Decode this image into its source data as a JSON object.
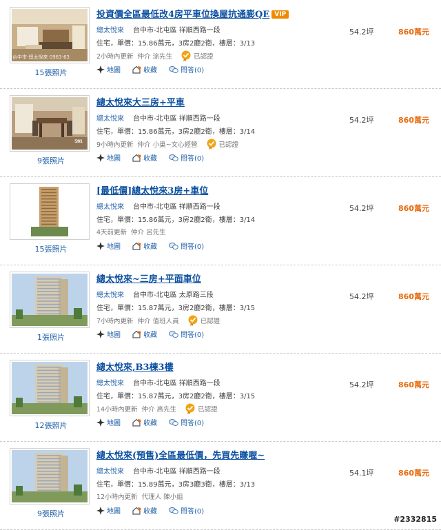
{
  "listings": [
    {
      "title": "投資價全區最低改4房平車位換屋抗通膨QE",
      "vip": "VIP",
      "community": "總太悅來",
      "address": "台中市-北屯區  祥順西路一段",
      "detail": "住宅，單價：15.86萬元，3房2廳2衛，樓層：3/13",
      "update": "2小時內更新",
      "agent": "仲介  涂先生",
      "verified": "已認證",
      "photos": "15張照片",
      "area": "54.2坪",
      "price": "860萬元",
      "actions": {
        "map": "地圖",
        "fav": "收藏",
        "qa": "問答(0)"
      },
      "thumb_type": "interior",
      "thumb_caption": "台中市-總太悅來 0963-63"
    },
    {
      "title": "總太悅來大三房+平車",
      "community": "總太悅來",
      "address": "台中市-北屯區  祥順西路一段",
      "detail": "住宅，單價：15.86萬元，3房2廳2衛，樓層：3/14",
      "update": "9小時內更新",
      "agent": "仲介  小巢~文心經營",
      "verified": "已認證",
      "photos": "9張照片",
      "area": "54.2坪",
      "price": "860萬元",
      "actions": {
        "map": "地圖",
        "fav": "收藏",
        "qa": "問答(0)"
      },
      "thumb_type": "dining",
      "thumb_caption": "591"
    },
    {
      "title": "[最低價]總太悅來3房+車位",
      "community": "總太悅來",
      "address": "台中市-北屯區  祥順西路一段",
      "detail": "住宅，單價：15.86萬元，3房2廳2衛，樓層：3/14",
      "update": "4天前更新",
      "agent": "仲介  呂先生",
      "verified": "",
      "photos": "15張照片",
      "area": "54.2坪",
      "price": "860萬元",
      "actions": {
        "map": "地圖",
        "fav": "收藏",
        "qa": "問答(0)"
      },
      "thumb_type": "tower-warm"
    },
    {
      "title": "總太悅來~三房+平面車位",
      "community": "總太悅來",
      "address": "台中市-北屯區  太原路三段",
      "detail": "住宅，單價：15.87萬元，3房2廳2衛，樓層：3/15",
      "update": "7小時內更新",
      "agent": "仲介  值班人員",
      "verified": "已認證",
      "photos": "1張照片",
      "area": "54.2坪",
      "price": "860萬元",
      "actions": {
        "map": "地圖",
        "fav": "收藏",
        "qa": "問答(0)"
      },
      "thumb_type": "tower"
    },
    {
      "title": "總太悅來,B3棟3樓",
      "community": "總太悅來",
      "address": "台中市-北屯區  祥順西路一段",
      "detail": "住宅，單價：15.87萬元，3房2廳2衛，樓層：3/15",
      "update": "14小時內更新",
      "agent": "仲介  高先生",
      "verified": "已認證",
      "photos": "12張照片",
      "area": "54.2坪",
      "price": "860萬元",
      "actions": {
        "map": "地圖",
        "fav": "收藏",
        "qa": "問答(0)"
      },
      "thumb_type": "tower"
    },
    {
      "title": "總太悅來(預售)全區最低價，先買先賺喔~",
      "community": "總太悅來",
      "address": "台中市-北屯區  祥順西路一段",
      "detail": "住宅，單價：15.89萬元，3房3廳3衛，樓層：3/13",
      "update": "12小時內更新",
      "agent": "代理人  陳小姐",
      "verified": "",
      "photos": "9張照片",
      "area": "54.1坪",
      "price": "860萬元",
      "actions": {
        "map": "地圖",
        "fav": "收藏",
        "qa": "問答(0)"
      },
      "thumb_type": "tower"
    }
  ],
  "watermark": "#2332815",
  "colors": {
    "title": "#0b4fa0",
    "link": "#1f5fa8",
    "price": "#e86a0c",
    "vip": "#f08a00"
  }
}
